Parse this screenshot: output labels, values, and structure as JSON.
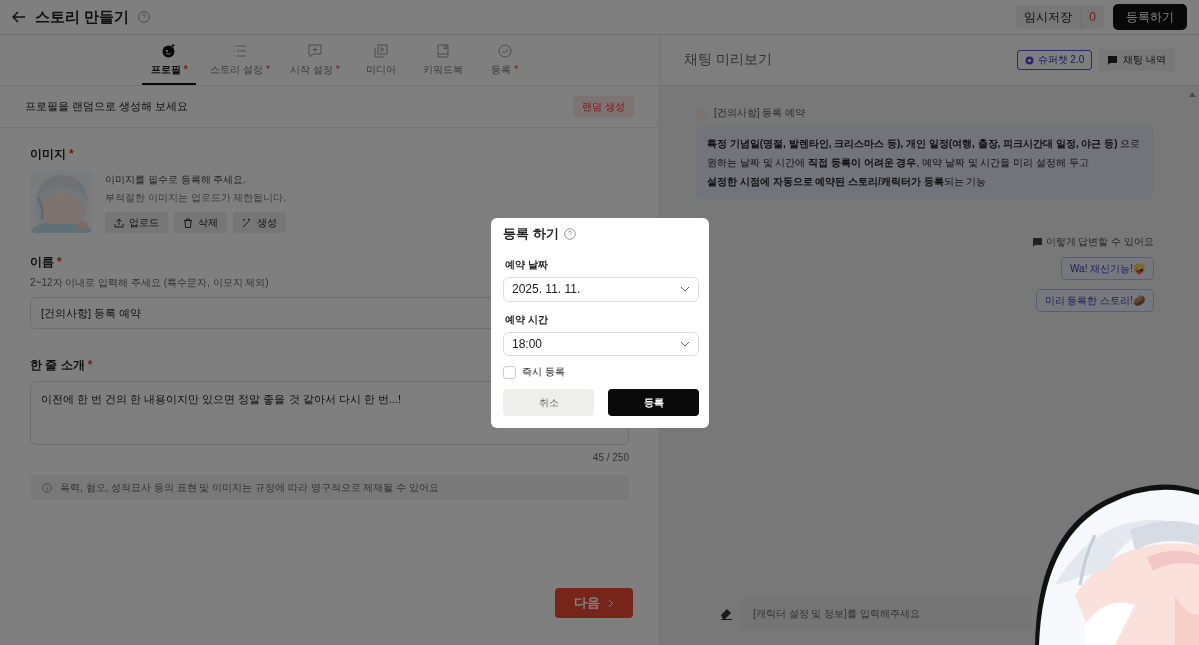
{
  "header": {
    "title": "스토리 만들기",
    "temp_save": "임시저장",
    "temp_count": "0",
    "submit": "등록하기"
  },
  "tabs": [
    {
      "label": "프로필",
      "required_mark": "*",
      "selected": true
    },
    {
      "label": "스토리 설정",
      "required_mark": "*",
      "selected": false
    },
    {
      "label": "시작 설정",
      "required_mark": "*",
      "selected": false
    },
    {
      "label": "미디어",
      "selected": false
    },
    {
      "label": "키워드북",
      "selected": false
    },
    {
      "label": "등록",
      "required_mark": "*",
      "selected": false
    }
  ],
  "random_bar": {
    "text": "프로필을 랜덤으로 생성해 보세요",
    "button": "랜덤 생성"
  },
  "image_section": {
    "label": "이미지",
    "required_mark": "*",
    "hint": "이미지를 필수로 등록해 주세요.",
    "note": "부적절한 이미지는 업로드가 제한됩니다.",
    "buttons": [
      "업로드",
      "삭제",
      "생성"
    ]
  },
  "name_section": {
    "label": "이름",
    "required_mark": "*",
    "hint": "2~12자 이내로 입력해 주세요 (특수문자, 이모지 제외)",
    "value": "[건의사항] 등록 예약"
  },
  "intro_section": {
    "label": "한 줄 소개",
    "required_mark": "*",
    "value": "이전에 한 번 건의 한 내용이지만 있으면 정말 좋을 것 같아서 다시 한 번...!",
    "counter": "45 / 250"
  },
  "notice": "폭력, 혐오, 성적묘사 등의 표현 및 이미지는 규정에 따라 영구적으로 제재될 수 있어요",
  "next_button": "다음",
  "preview": {
    "title": "채팅 미리보기",
    "superchat": "슈퍼챗 2.0",
    "history": "채팅 내역",
    "sender": "[건의사항] 등록 예약",
    "message_lines": [
      "**특정 기념일(명절, 발렌타인, 크리스마스 등), 개인 일정(여행, 출장, 피크시간대 일정, 야근 등)** 으로",
      "원하는 날짜 및 시간에 **직접 등록이 어려운 경우**, 예약 날짜 및 시간을 미리 설정해 두고",
      "**설정한 시점에 자동으로 예약된 스토리/캐릭터가 등록**되는 기능"
    ],
    "suggest_label": "이렇게 답변할 수 있어요",
    "suggestions": [
      "Wa! 채신기능!🤪",
      "미리 등록한 스토리!🥔"
    ],
    "input_placeholder": "[캐릭터 설정 및 정보]를 입력해주세요"
  },
  "modal": {
    "title": "등록 하기",
    "date_label": "예약 날짜",
    "date_value": "2025. 11. 11.",
    "time_label": "예약 시간",
    "time_value": "18:00",
    "instant": {
      "label": "즉시 등록",
      "checked": false
    },
    "cancel": "취소",
    "confirm": "등록"
  }
}
